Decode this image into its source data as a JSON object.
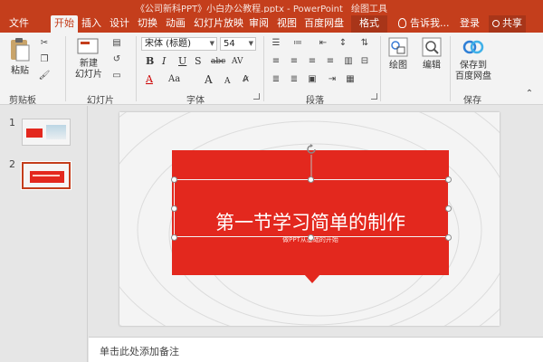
{
  "window": {
    "title": "《公司新科PPT》小白办公教程.pptx - PowerPoint",
    "contextual_title": "绘图工具"
  },
  "tabs": [
    {
      "label": "文件",
      "active": false
    },
    {
      "label": "开始",
      "active": true
    },
    {
      "label": "插入",
      "active": false
    },
    {
      "label": "设计",
      "active": false
    },
    {
      "label": "切换",
      "active": false
    },
    {
      "label": "动画",
      "active": false
    },
    {
      "label": "幻灯片放映",
      "active": false
    },
    {
      "label": "审阅",
      "active": false
    },
    {
      "label": "视图",
      "active": false
    },
    {
      "label": "百度网盘",
      "active": false
    },
    {
      "label": "格式",
      "active": false
    }
  ],
  "tell_me": "告诉我...",
  "login": "登录",
  "share": "共享",
  "ribbon": {
    "clipboard": {
      "paste": "粘贴",
      "group": "剪贴板"
    },
    "slides": {
      "new_slide_line1": "新建",
      "new_slide_line2": "幻灯片",
      "group": "幻灯片"
    },
    "font": {
      "family": "宋体 (标题)",
      "size": "54",
      "group": "字体",
      "bold": "B",
      "italic": "I",
      "underline": "U",
      "shadow": "S",
      "strike": "abc",
      "spacing": "AV",
      "case": "Aa",
      "grow": "A",
      "shrink": "A"
    },
    "paragraph": {
      "group": "段落"
    },
    "drawing": {
      "label": "绘图"
    },
    "editing": {
      "label": "编辑"
    },
    "baidu": {
      "line1": "保存到",
      "line2": "百度网盘",
      "group": "保存"
    }
  },
  "thumbnails": [
    {
      "number": "1",
      "selected": false
    },
    {
      "number": "2",
      "selected": true
    }
  ],
  "slide": {
    "title": "第一节学习简单的制作",
    "subtitle": "做PPT从基础的开始",
    "accent_color": "#e3281e"
  },
  "notes": {
    "placeholder": "单击此处添加备注"
  },
  "colors": {
    "brand": "#c43e1c",
    "ribbon_bg": "#f3f3f3"
  }
}
